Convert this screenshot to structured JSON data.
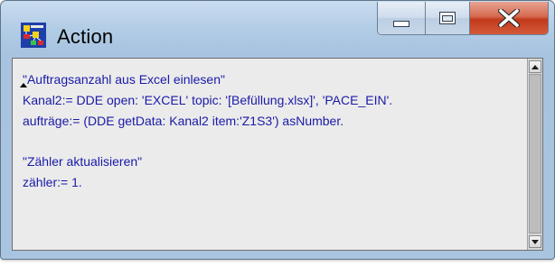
{
  "window": {
    "title": "Action",
    "icon": "action-app-icon",
    "controls": {
      "minimize": "minimize-icon",
      "maximize": "maximize-icon",
      "close": "close-icon"
    }
  },
  "editor": {
    "lines": [
      "\"Auftragsanzahl aus Excel einlesen\"",
      "Kanal2:= DDE open: 'EXCEL' topic: '[Befüllung.xlsx]', 'PACE_EIN'.",
      "aufträge:= (DDE getData: Kanal2 item:'Z1S3') asNumber.",
      "",
      "\"Zähler aktualisieren\"",
      "zähler:= 1."
    ],
    "text_color": "#1a1aa8"
  },
  "colors": {
    "close_button": "#c2391b",
    "window_frame": "#a7c3df",
    "editor_background": "#ebebeb"
  }
}
